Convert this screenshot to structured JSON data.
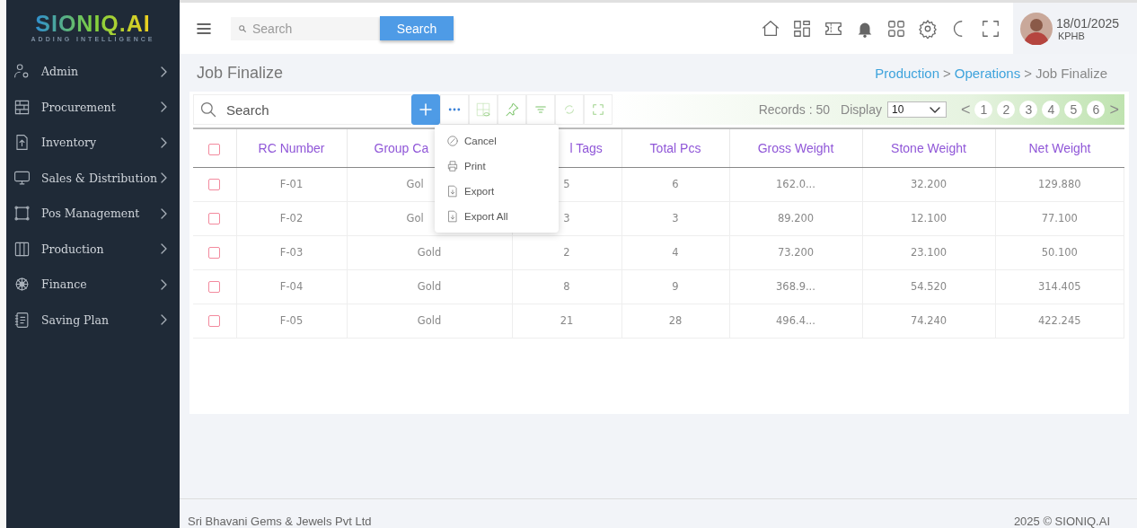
{
  "logo": {
    "name": "SIONIQ.AI",
    "tagline": "ADDING INTELLIGENCE"
  },
  "top_search": {
    "placeholder": "Search",
    "button": "Search"
  },
  "user": {
    "date": "18/01/2025",
    "location": "KPHB"
  },
  "sidebar": {
    "items": [
      {
        "label": "Admin"
      },
      {
        "label": "Procurement"
      },
      {
        "label": "Inventory"
      },
      {
        "label": "Sales & Distribution"
      },
      {
        "label": "Pos Management"
      },
      {
        "label": "Production"
      },
      {
        "label": "Finance"
      },
      {
        "label": "Saving Plan"
      }
    ]
  },
  "page_title": "Job Finalize",
  "breadcrumb": {
    "separator": ">",
    "items": [
      {
        "label": "Production",
        "link": true
      },
      {
        "label": "Operations",
        "link": true
      },
      {
        "label": "Job Finalize",
        "link": false
      }
    ]
  },
  "toolbar": {
    "search_placeholder": "Search",
    "records": "Records : 50",
    "display_label": "Display",
    "display_value": "10",
    "prev": "<",
    "next": ">",
    "pages": [
      "1",
      "2",
      "3",
      "4",
      "5",
      "6"
    ]
  },
  "menu": {
    "items": [
      "Cancel",
      "Print",
      "Export",
      "Export All"
    ]
  },
  "table": {
    "all_checked": false,
    "columns": [
      {
        "label": "RC Number"
      },
      {
        "label": "Group Ca"
      },
      {
        "label": "l Tags"
      },
      {
        "label": "Total Pcs"
      },
      {
        "label": "Gross Weight"
      },
      {
        "label": "Stone Weight"
      },
      {
        "label": "Net Weight"
      }
    ],
    "rows": [
      {
        "checked": false,
        "cells": [
          "F-01",
          "Gol",
          "5",
          "6",
          "162.0...",
          "32.200",
          "129.880"
        ]
      },
      {
        "checked": false,
        "cells": [
          "F-02",
          "Gol",
          "3",
          "3",
          "89.200",
          "12.100",
          "77.100"
        ]
      },
      {
        "checked": false,
        "cells": [
          "F-03",
          "Gold",
          "2",
          "4",
          "73.200",
          "23.100",
          "50.100"
        ]
      },
      {
        "checked": false,
        "cells": [
          "F-04",
          "Gold",
          "8",
          "9",
          "368.9...",
          "54.520",
          "314.405"
        ]
      },
      {
        "checked": false,
        "cells": [
          "F-05",
          "Gold",
          "21",
          "28",
          "496.4...",
          "74.240",
          "422.245"
        ]
      }
    ]
  },
  "footer": {
    "company": "Sri Bhavani Gems & Jewels Pvt Ltd",
    "copyright": "2025 © SIONIQ.AI"
  }
}
